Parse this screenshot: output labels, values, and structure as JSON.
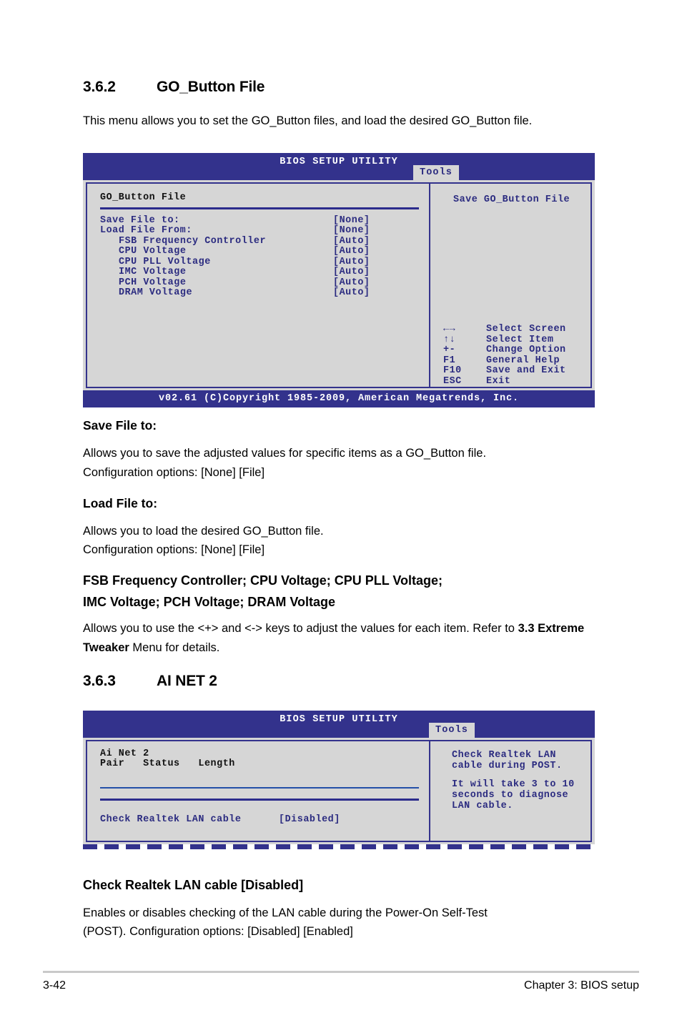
{
  "section_362": {
    "number": "3.6.2",
    "title": "GO_Button File",
    "intro": "This menu allows you to set the GO_Button files, and load the desired GO_Button file."
  },
  "bios_screen_1": {
    "title": "BIOS SETUP UTILITY",
    "tab": "Tools",
    "panel_title": "GO_Button File",
    "items": [
      {
        "label": "Save File to:",
        "value": "[None]",
        "indent": 0
      },
      {
        "label": "Load File From:",
        "value": "[None]",
        "indent": 0
      },
      {
        "label": "FSB Frequency Controller",
        "value": "[Auto]",
        "indent": 1
      },
      {
        "label": "CPU Voltage",
        "value": "[Auto]",
        "indent": 1
      },
      {
        "label": "CPU PLL Voltage",
        "value": "[Auto]",
        "indent": 1
      },
      {
        "label": "IMC Voltage",
        "value": "[Auto]",
        "indent": 1
      },
      {
        "label": "PCH Voltage",
        "value": "[Auto]",
        "indent": 1
      },
      {
        "label": "DRAM Voltage",
        "value": "[Auto]",
        "indent": 1
      }
    ],
    "help_title": "Save GO_Button File",
    "key_legend": [
      {
        "key": "←→",
        "action": "Select Screen"
      },
      {
        "key": "↑↓",
        "action": "Select Item"
      },
      {
        "key": "+-",
        "action": "Change Option"
      },
      {
        "key": "F1",
        "action": "General Help"
      },
      {
        "key": "F10",
        "action": "Save and Exit"
      },
      {
        "key": "ESC",
        "action": "Exit"
      }
    ],
    "footer": "v02.61 (C)Copyright 1985-2009, American Megatrends, Inc."
  },
  "save_file_to": {
    "heading": "Save File to:",
    "body_line1": "Allows you to save the adjusted values for specific items as a GO_Button file.",
    "body_line2": "Configuration options: [None] [File]"
  },
  "load_file_to": {
    "heading": "Load File to:",
    "body_line1": "Allows you to load the desired GO_Button file.",
    "body_line2": "Configuration options: [None] [File]"
  },
  "voltage_items": {
    "heading_line1": "FSB Frequency Controller; CPU Voltage; CPU PLL Voltage;",
    "heading_line2": "IMC Voltage; PCH Voltage; DRAM Voltage",
    "body_part1": "Allows you to use the <+> and <-> keys to adjust the values for each item. Refer to ",
    "body_bold": "3.3 Extreme Tweaker",
    "body_part2": " Menu for details."
  },
  "section_363": {
    "number": "3.6.3",
    "title": "AI NET 2"
  },
  "bios_screen_2": {
    "title": "BIOS SETUP UTILITY",
    "tab": "Tools",
    "panel_title": "Ai Net 2",
    "table_header": "Pair   Status   Length",
    "item_label": "Check Realtek LAN cable",
    "item_value": "[Disabled]",
    "help_para1": "Check Realtek LAN\ncable during POST.",
    "help_para2": "It will take 3 to 10\nseconds to diagnose\nLAN cable."
  },
  "check_lan": {
    "heading": "Check Realtek LAN cable [Disabled]",
    "body_line1": "Enables or disables checking of the LAN cable during the Power-On Self-Test",
    "body_line2": "(POST). Configuration options: [Disabled] [Enabled]"
  },
  "page_footer": {
    "page_number": "3-42",
    "chapter": "Chapter 3: BIOS setup"
  },
  "colors": {
    "bios_blue": "#33328c",
    "bios_text": "#2b2b80",
    "bios_bg": "#d6d6d6",
    "rule_blue": "#2450a8"
  }
}
